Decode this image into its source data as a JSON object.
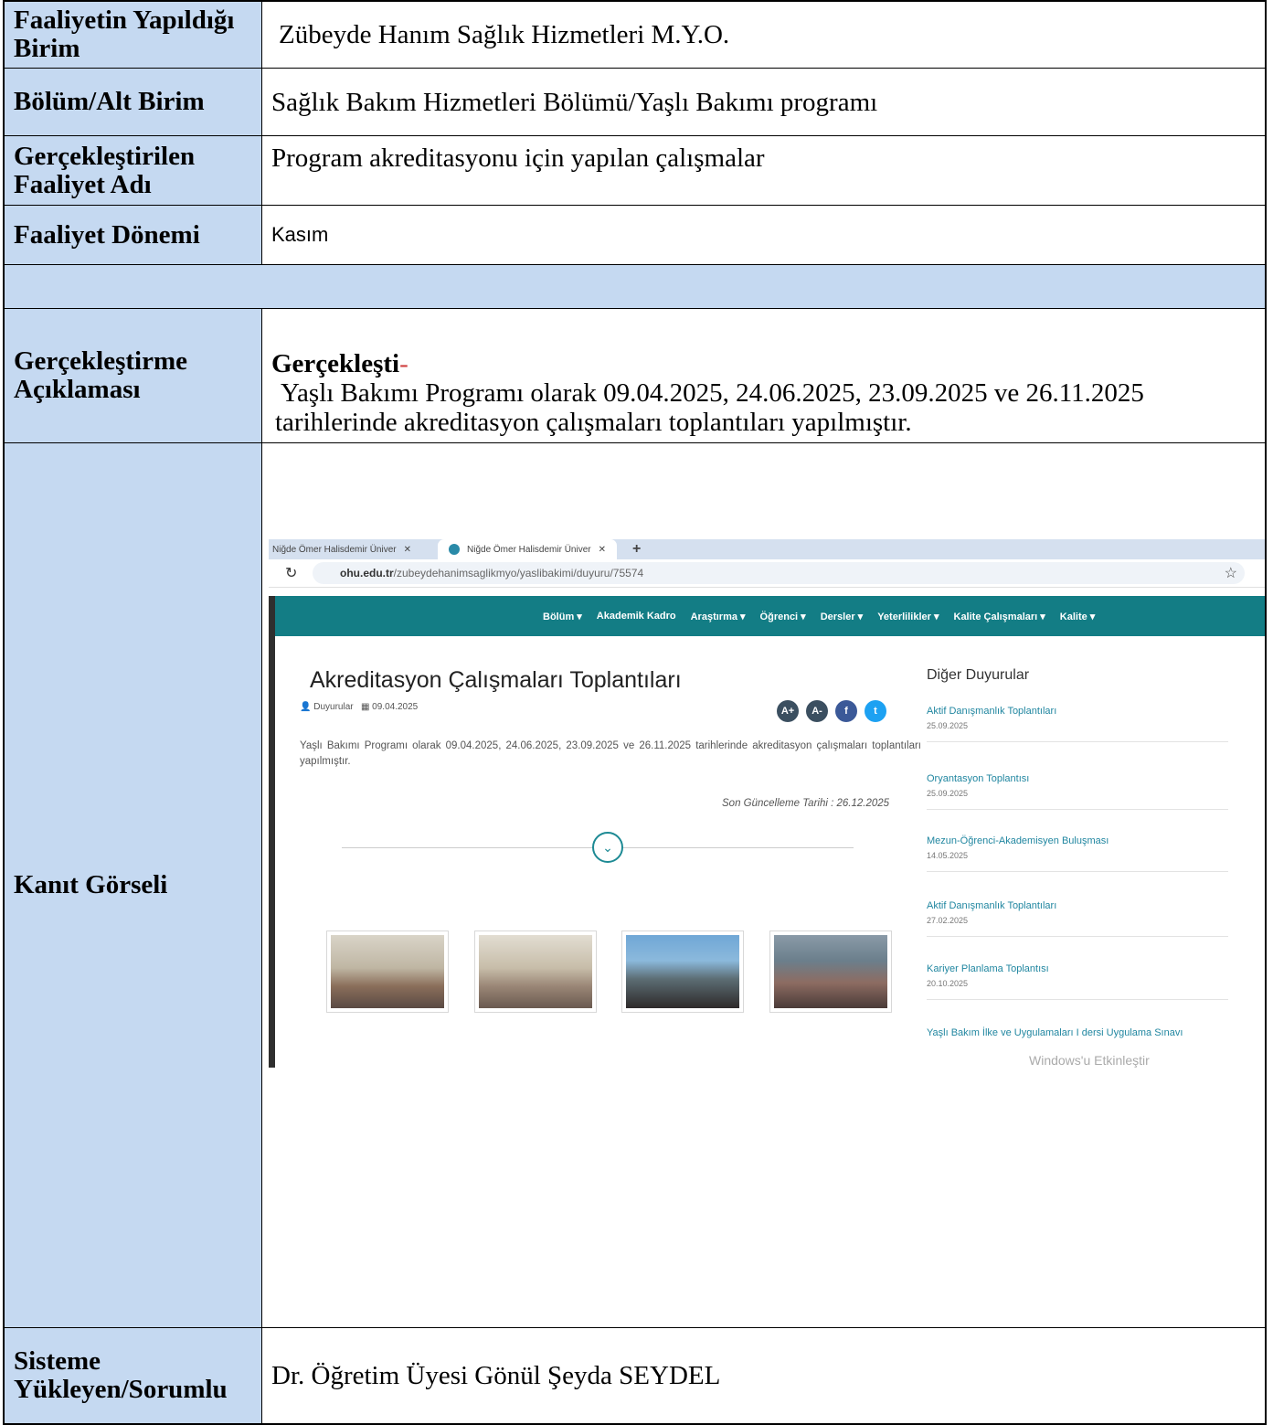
{
  "rows": {
    "unit": {
      "label": "Faaliyetin Yapıldığı Birim",
      "value": "Zübeyde Hanım Sağlık Hizmetleri M.Y.O."
    },
    "dept": {
      "label": "Bölüm/Alt Birim",
      "value": "Sağlık Bakım Hizmetleri Bölümü/Yaşlı Bakımı programı"
    },
    "activity": {
      "label_line1": "Gerçekleştirilen",
      "label_line2": "Faaliyet Adı",
      "value": "Program akreditasyonu için yapılan çalışmalar"
    },
    "period": {
      "label": "Faaliyet Dönemi",
      "value": "Kasım"
    },
    "explanation": {
      "label_line1": "Gerçekleştirme",
      "label_line2": "Açıklaması",
      "status": "Gerçekleşti",
      "status_suffix": "-",
      "text_line1": "Yaşlı Bakımı Programı olarak 09.04.2025, 24.06.2025, 23.09.2025 ve 26.11.2025",
      "text_line2": "tarihlerinde akreditasyon çalışmaları toplantıları yapılmıştır."
    },
    "evidence": {
      "label": "Kanıt Görseli"
    },
    "uploader": {
      "label_line1": "Sisteme",
      "label_line2": "Yükleyen/Sorumlu",
      "value": "Dr. Öğretim Üyesi Gönül Şeyda SEYDEL"
    }
  },
  "screenshot": {
    "tabs": [
      "Niğde Ömer Halisdemir Üniver",
      "Niğde Ömer Halisdemir Üniver"
    ],
    "url_domain": "ohu.edu.tr",
    "url_path": "/zubeydehanimsaglikmyo/yaslibakimi/duyuru/75574",
    "nav": [
      "Bölüm ▾",
      "Akademik Kadro",
      "Araştırma ▾",
      "Öğrenci ▾",
      "Dersler ▾",
      "Yeterlilikler ▾",
      "Kalite Çalışmaları ▾",
      "Kalite ▾"
    ],
    "title": "Akreditasyon Çalışmaları Toplantıları",
    "meta_category": "Duyurular",
    "meta_date": "09.04.2025",
    "body": "Yaşlı Bakımı Programı olarak 09.04.2025, 24.06.2025, 23.09.2025 ve 26.11.2025 tarihlerinde akreditasyon çalışmaları toplantıları yapılmıştır.",
    "updated": "Son Güncelleme Tarihi : 26.12.2025",
    "sidebar_title": "Diğer Duyurular",
    "news": [
      {
        "title": "Aktif Danışmanlık Toplantıları",
        "date": "25.09.2025"
      },
      {
        "title": "Oryantasyon Toplantısı",
        "date": "25.09.2025"
      },
      {
        "title": "Mezun-Öğrenci-Akademisyen Buluşması",
        "date": "14.05.2025"
      },
      {
        "title": "Aktif Danışmanlık Toplantıları",
        "date": "27.02.2025"
      },
      {
        "title": "Kariyer Planlama Toplantısı",
        "date": "20.10.2025"
      },
      {
        "title": "Yaşlı Bakım İlke ve Uygulamaları I dersi Uygulama Sınavı",
        "date": ""
      }
    ],
    "watermark": "Windows'u Etkinleştir",
    "social": [
      "A+",
      "A-",
      "f",
      "t"
    ],
    "colors": {
      "teal": "#137d85",
      "link": "#2086a0",
      "label_bg": "#c5d9f1"
    }
  }
}
